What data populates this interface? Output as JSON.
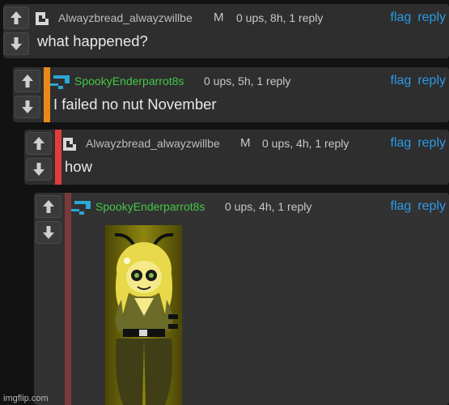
{
  "actions": {
    "flag": "flag",
    "reply": "reply"
  },
  "comments": [
    {
      "user": "Alwayzbread_alwayzwillbe",
      "badge": "M",
      "meta": "0 ups, 8h, 1 reply",
      "text": "what happened?",
      "avatar": "pixel-avatar-icon"
    },
    {
      "user": "SpookyEnderparrot8s",
      "badge": "",
      "meta": "0 ups, 5h, 1 reply",
      "text": "I failed no nut November",
      "avatar": "parrot-avatar-icon",
      "bar_color": "#e8891a"
    },
    {
      "user": "Alwayzbread_alwayzwillbe",
      "badge": "M",
      "meta": "0 ups, 4h, 1 reply",
      "text": "how",
      "avatar": "pixel-avatar-icon",
      "bar_color": "#e23b3b"
    },
    {
      "user": "SpookyEnderparrot8s",
      "badge": "",
      "meta": "0 ups, 4h, 1 reply",
      "text": "",
      "avatar": "parrot-avatar-icon",
      "bar_color": "#7a3a3a"
    }
  ],
  "watermark": "imgflip.com",
  "colors": {
    "accent": "#2b9be6",
    "username_green": "#45c747",
    "background": "#121212"
  }
}
